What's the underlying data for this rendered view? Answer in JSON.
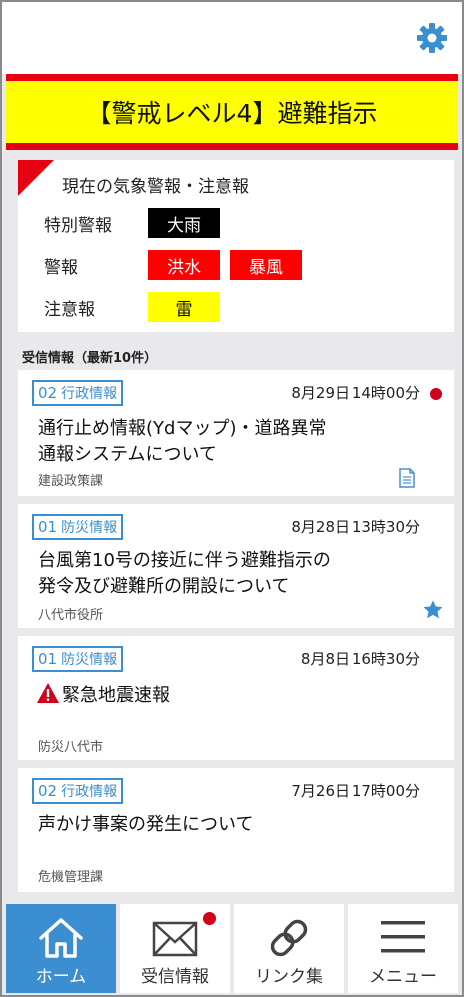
{
  "alert_banner": {
    "text": "【警戒レベル4】避難指示",
    "color_bg": "#ffff00",
    "color_border": "#e60012"
  },
  "warnings": {
    "title": "現在の気象警報・注意報",
    "rows": [
      {
        "label": "特別警報",
        "tags": [
          "大雨"
        ],
        "color": "#000000"
      },
      {
        "label": "警報",
        "tags": [
          "洪水",
          "暴風"
        ],
        "color": "#ff0000"
      },
      {
        "label": "注意報",
        "tags": [
          "雷"
        ],
        "color": "#ffff00"
      }
    ]
  },
  "messages": {
    "heading": "受信情報（最新10件）",
    "items": [
      {
        "cat_num": "02",
        "cat_label": "行政情報",
        "date": "8月29日",
        "time": "14時00分",
        "title_line1": "通行止め情報(Ydマップ)・道路異常",
        "title_line2": "通報システムについて",
        "sender": "建設政策課",
        "unread": true,
        "icon": "document-icon"
      },
      {
        "cat_num": "01",
        "cat_label": "防災情報",
        "date": "8月28日",
        "time": "13時30分",
        "title_line1": "台風第10号の接近に伴う避難指示の",
        "title_line2": "発令及び避難所の開設について",
        "sender": "八代市役所",
        "icon": "star-icon"
      },
      {
        "cat_num": "01",
        "cat_label": "防災情報",
        "date": "8月8日",
        "time": "16時30分",
        "title_line1": "緊急地震速報",
        "sender": "防災八代市",
        "icon": "warning-icon"
      },
      {
        "cat_num": "02",
        "cat_label": "行政情報",
        "date": "7月26日",
        "time": "17時00分",
        "title_line1": "声かけ事案の発生について",
        "sender": "危機管理課"
      }
    ]
  },
  "tabs": [
    {
      "label": "ホーム",
      "icon": "home-icon",
      "active": true
    },
    {
      "label": "受信情報",
      "icon": "mail-icon",
      "badge": true
    },
    {
      "label": "リンク集",
      "icon": "link-icon"
    },
    {
      "label": "メニュー",
      "icon": "menu-icon"
    }
  ],
  "colors": {
    "accent": "#3b8fd0",
    "alert_red": "#e60012",
    "unread": "#d0021b"
  },
  "settings_icon": "gear-icon"
}
